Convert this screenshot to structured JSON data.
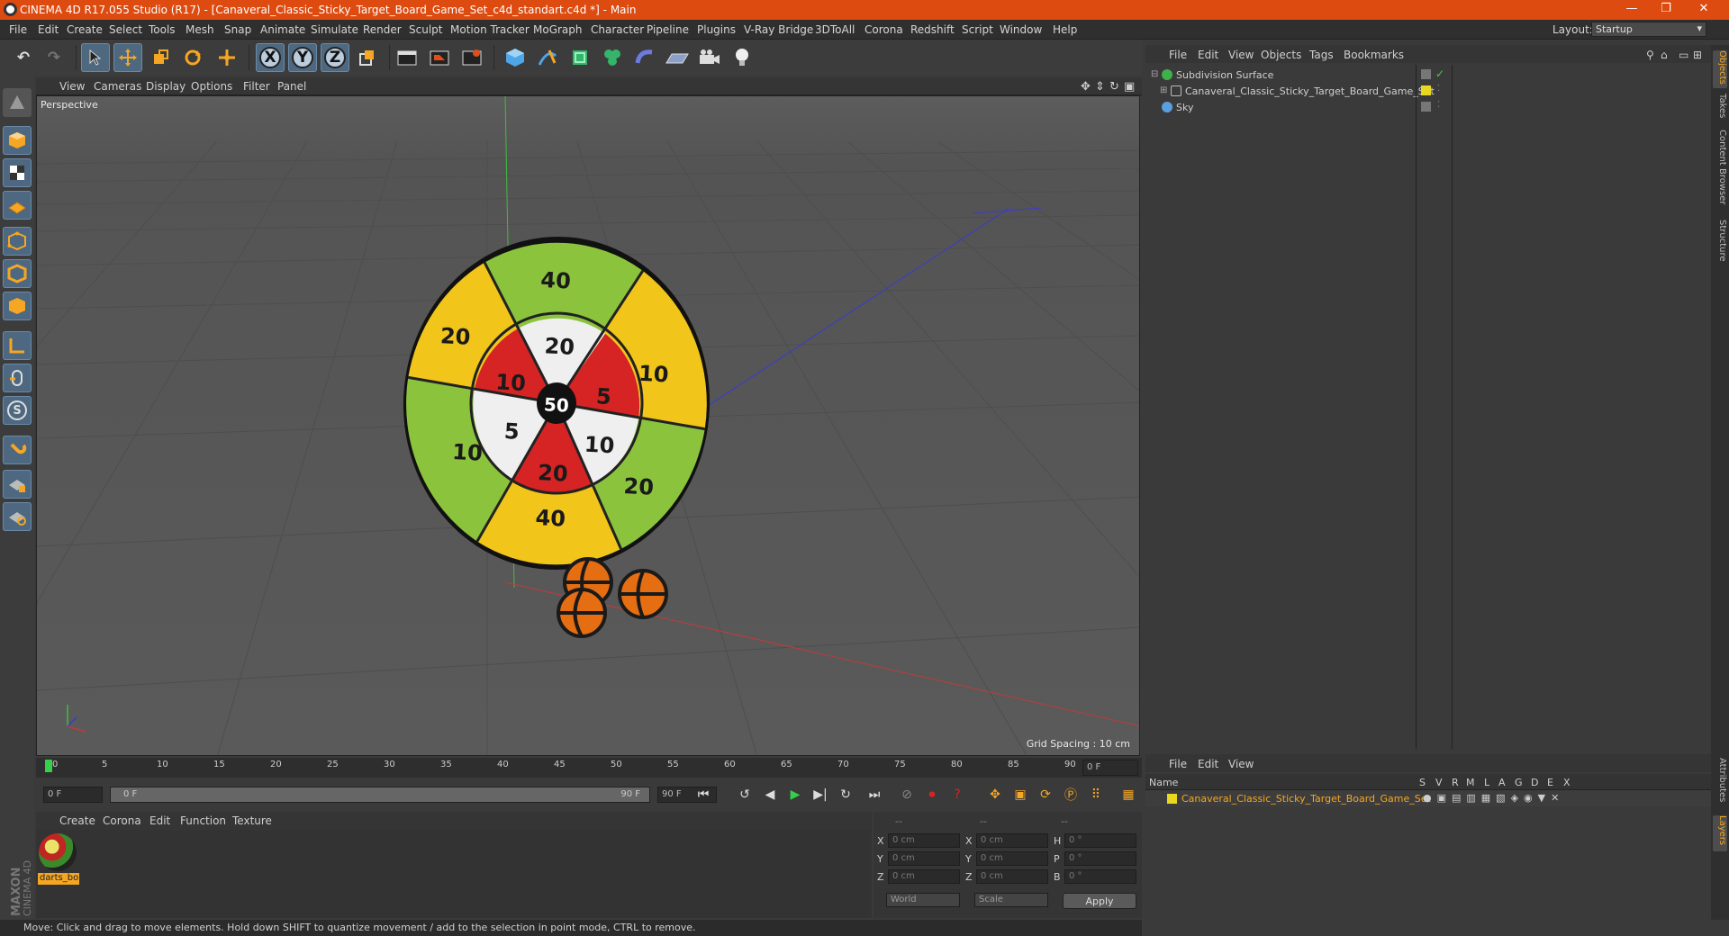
{
  "window": {
    "title": "CINEMA 4D R17.055 Studio (R17) - [Canaveral_Classic_Sticky_Target_Board_Game_Set_c4d_standart.c4d *] - Main",
    "minimize": "—",
    "maximize": "❐",
    "close": "✕"
  },
  "menubar": {
    "items": [
      "File",
      "Edit",
      "Create",
      "Select",
      "Tools",
      "Mesh",
      "Snap",
      "Animate",
      "Simulate",
      "Render",
      "Sculpt",
      "Motion Tracker",
      "MoGraph",
      "Character",
      "Pipeline",
      "Plugins",
      "V-Ray Bridge",
      "3DToAll",
      "Corona",
      "Redshift",
      "Script",
      "Window",
      "Help"
    ],
    "layout_label": "Layout:",
    "layout_value": "Startup"
  },
  "toolbar": {
    "undo": "↶",
    "redo": "↷",
    "x": "X",
    "y": "Y",
    "z": "Z"
  },
  "viewport": {
    "menu": [
      "View",
      "Cameras",
      "Display",
      "Options",
      "Filter",
      "Panel"
    ],
    "label": "Perspective",
    "grid_spacing": "Grid Spacing : 10 cm",
    "board_numbers": [
      "40",
      "20",
      "10",
      "20",
      "5",
      "10",
      "5",
      "10",
      "10",
      "20",
      "20",
      "40",
      "50"
    ]
  },
  "timeline": {
    "ticks": [
      "0",
      "5",
      "10",
      "15",
      "20",
      "25",
      "30",
      "35",
      "40",
      "45",
      "50",
      "55",
      "60",
      "65",
      "70",
      "75",
      "80",
      "85",
      "90"
    ],
    "frame_end_display": "0 F",
    "start_field": "0 F",
    "range_start": "0 F",
    "range_end": "90 F",
    "end_field": "90 F"
  },
  "materials": {
    "menu": [
      "Create",
      "Corona",
      "Edit",
      "Function",
      "Texture"
    ],
    "item_name": "darts_bo"
  },
  "coordinates": {
    "header": [
      "--",
      "--",
      "--"
    ],
    "rows": [
      {
        "a": "X",
        "av": "0 cm",
        "b": "X",
        "bv": "0 cm",
        "c": "H",
        "cv": "0 °"
      },
      {
        "a": "Y",
        "av": "0 cm",
        "b": "Y",
        "bv": "0 cm",
        "c": "P",
        "cv": "0 °"
      },
      {
        "a": "Z",
        "av": "0 cm",
        "b": "Z",
        "bv": "0 cm",
        "c": "B",
        "cv": "0 °"
      }
    ],
    "world": "World",
    "scale": "Scale",
    "apply": "Apply"
  },
  "status": "Move: Click and drag to move elements. Hold down SHIFT to quantize movement / add to the selection in point mode, CTRL to remove.",
  "objects": {
    "menu": [
      "File",
      "Edit",
      "View",
      "Objects",
      "Tags",
      "Bookmarks"
    ],
    "tree": [
      {
        "name": "Subdivision Surface",
        "color": "#3fb04a"
      },
      {
        "name": "Canaveral_Classic_Sticky_Target_Board_Game_Set",
        "color": "#cfcfcf"
      },
      {
        "name": "Sky",
        "color": "#5aa0e0"
      }
    ]
  },
  "layers": {
    "menu": [
      "File",
      "Edit",
      "View"
    ],
    "header": [
      "Name",
      "S",
      "V",
      "R",
      "M",
      "L",
      "A",
      "G",
      "D",
      "E",
      "X"
    ],
    "row": "Canaveral_Classic_Sticky_Target_Board_Game_Set"
  },
  "side_tabs": [
    "Objects",
    "Takes",
    "Content Browser",
    "Structure",
    "Attributes",
    "Layers"
  ],
  "colors": {
    "title_bar": "#dd4b10",
    "accent": "#f5a623"
  }
}
